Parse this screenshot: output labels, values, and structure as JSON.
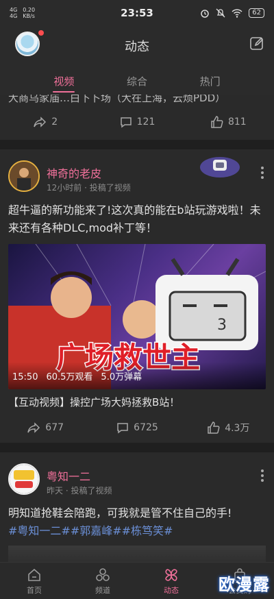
{
  "status_bar": {
    "net_top": "4G",
    "net_bottom": "4G",
    "speed": "0.20",
    "speed_unit": "KB/s",
    "time": "23:53",
    "battery": "62"
  },
  "header": {
    "title": "动态"
  },
  "tabs": [
    {
      "label": "视频",
      "active": true
    },
    {
      "label": "综合",
      "active": false
    },
    {
      "label": "热门",
      "active": false
    }
  ],
  "partial_post": {
    "text": "大商乌家庙…白下卜场（大在上海，云烦PDD）",
    "share": "2",
    "comment": "121",
    "like": "811"
  },
  "post1": {
    "username": "神奇的老皮",
    "meta": "12小时前 · 投稿了视频",
    "text": "超牛逼的新功能来了!这次真的能在b站玩游戏啦！未来还有各种DLC,mod补丁等！",
    "video_title_art": "广场救世主",
    "duration": "15:50",
    "views": "60.5万观看",
    "danmaku": "5.0万弹幕",
    "caption": "【互动视频】操控广场大妈拯救B站！",
    "share": "677",
    "comment": "6725",
    "like": "4.3万"
  },
  "post2": {
    "username": "粤知一二",
    "meta": "昨天 · 投稿了视频",
    "text": "明知道抢鞋会陪跑，可我就是管不住自己的手!",
    "tags": "#粤知一二##郭嘉峰##栋笃笑#"
  },
  "bottom_nav": [
    {
      "label": "首页",
      "icon": "home-icon",
      "active": false
    },
    {
      "label": "频道",
      "icon": "channel-icon",
      "active": false
    },
    {
      "label": "动态",
      "icon": "pinwheel-icon",
      "active": true
    },
    {
      "label": "会员购",
      "icon": "bag-icon",
      "active": false
    }
  ],
  "watermark": "欧漫露",
  "colors": {
    "accent": "#f0709a",
    "background": "#2a2a2a",
    "tag": "#6b8fd6"
  }
}
